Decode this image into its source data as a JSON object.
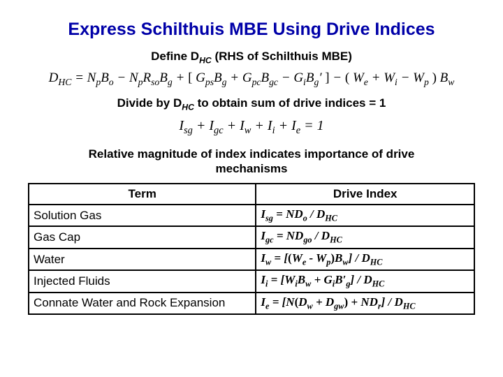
{
  "title": "Express Schilthuis MBE Using Drive Indices",
  "sub1_pre": "Define D",
  "sub1_sub": "HC",
  "sub1_post": " (RHS of Schilthuis MBE)",
  "eq1": {
    "D": "D",
    "D_s": "HC",
    "eq": " = ",
    "N1": "N",
    "N1_s": "p",
    "B1": "B",
    "B1_s": "o",
    "minus1": " − ",
    "N2": "N",
    "N2_s": "p",
    "R2": "R",
    "R2_s": "so",
    "B2": "B",
    "B2_s": "g",
    "plus1": " + ",
    "lb1": "[ ",
    "G3": "G",
    "G3_s": "ps",
    "B3": "B",
    "B3_s": "g",
    "plus2": " + ",
    "G4": "G",
    "G4_s": "pc",
    "B4": "B",
    "B4_s": "gc",
    "minus2": " − ",
    "G5": "G",
    "G5_s": "i",
    "B5": "B",
    "B5_s": "g",
    "prime": "′",
    "rb1": " ]",
    "minus3": " − ",
    "lp": "( ",
    "W6": "W",
    "W6_s": "e",
    "plus3": " + ",
    "W7": "W",
    "W7_s": "i",
    "minus4": " − ",
    "W8": "W",
    "W8_s": "p",
    "rp": " )",
    "B9": "B",
    "B9_s": "w"
  },
  "sub2_pre": "Divide by D",
  "sub2_sub": "HC",
  "sub2_post": " to obtain sum of drive indices = 1",
  "eq2": {
    "I1": "I",
    "I1_s": "sg",
    "p1": " + ",
    "I2": "I",
    "I2_s": "gc",
    "p2": " + ",
    "I3": "I",
    "I3_s": "w",
    "p3": " + ",
    "I4": "I",
    "I4_s": "i",
    "p4": " + ",
    "I5": "I",
    "I5_s": "e",
    "eq": " = 1"
  },
  "relmag": "Relative magnitude of index indicates importance of drive mechanisms",
  "table": {
    "h_term": "Term",
    "h_idx": "Drive Index",
    "rows": [
      {
        "term": "Solution Gas",
        "i": "I",
        "is": "sg",
        "eq": " = ",
        "a": "ND",
        "as": "o",
        "mid": " / ",
        "d": "D",
        "ds": "HC"
      },
      {
        "term": "Gas Cap",
        "i": "I",
        "is": "gc",
        "eq": " = ",
        "a": "ND",
        "as": "go",
        "mid": " / ",
        "d": "D",
        "ds": "HC"
      },
      {
        "term": "Water",
        "i": "I",
        "is": "w",
        "eq": " = [",
        "lp": "(",
        "w1": "W",
        "w1s": "e",
        "m": " - ",
        "w2": "W",
        "w2s": "p",
        "rp": ")",
        "b": "B",
        "bs": "w",
        "rb": "] / ",
        "d": "D",
        "ds": "HC"
      },
      {
        "term": "Injected Fluids",
        "i": "I",
        "is": "i",
        "eq": " = [",
        "w": "W",
        "ws": "i",
        "b1": "B",
        "b1s": "w",
        "pl": " + ",
        "g": "G",
        "gs": "i",
        "b2": "B",
        "b2s": "′",
        "b2s2": "g",
        "rb": "] / ",
        "d": "D",
        "ds": "HC"
      },
      {
        "term": "Connate Water and Rock Expansion",
        "i": "I",
        "is": "e",
        "eq": " = [",
        "n": "N",
        "lp": "(",
        "d1": "D",
        "d1s": "w",
        "pl": " + ",
        "d2": "D",
        "d2s": "gw",
        "rp": ")",
        "pl2": " + ",
        "nd": "ND",
        "nds": "r",
        "rb": "] / ",
        "d": "D",
        "ds": "HC"
      }
    ]
  }
}
